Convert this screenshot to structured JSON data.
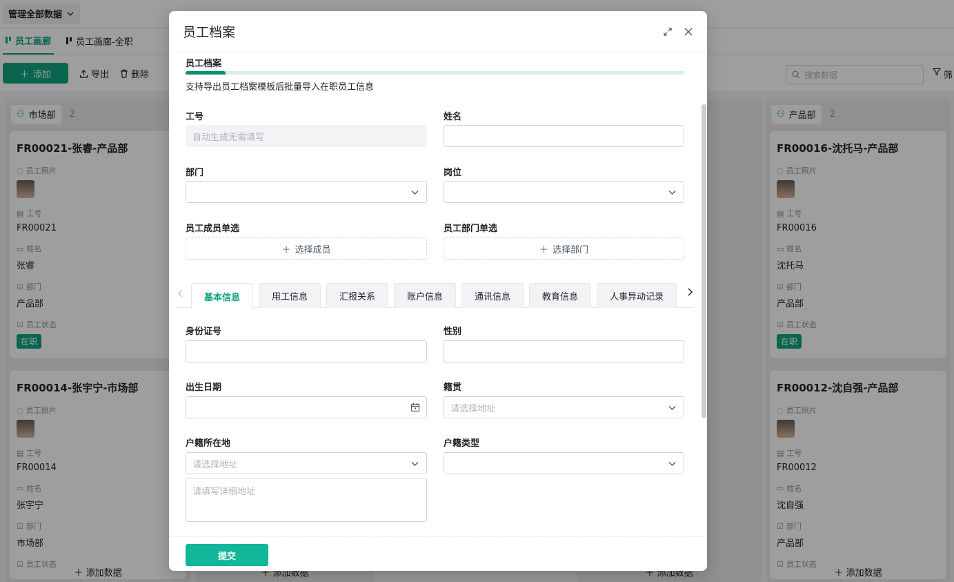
{
  "app": {
    "scope_label": "管理全部数据",
    "view_tabs": [
      "员工画廊",
      "员工画廊-全职"
    ],
    "toolbar": {
      "add": "添加",
      "export": "导出",
      "delete": "删除"
    },
    "search_placeholder": "搜索数据",
    "filter_label": "筛",
    "columns": [
      {
        "name": "市场部",
        "count": "2",
        "footer": "添加数据",
        "cards": [
          {
            "title": "FR00021-张睿-产品部",
            "photo_label": "员工照片",
            "id_label": "工号",
            "id": "FR00021",
            "name_label": "姓名",
            "name": "张睿",
            "dept_label": "部门",
            "dept": "产品部",
            "status_label": "员工状态",
            "status": "在职"
          },
          {
            "title": "FR00014-张宇宁-市场部",
            "photo_label": "员工照片",
            "id_label": "工号",
            "id": "FR00014",
            "name_label": "姓名",
            "name": "张宇宁",
            "dept_label": "部门",
            "dept": "市场部",
            "status_label": "员工状态"
          }
        ]
      },
      {
        "name": "产品部",
        "count": "2",
        "footer": "添加数据",
        "cards": [
          {
            "title": "FR00016-沈托马-产品部",
            "photo_label": "员工照片",
            "id_label": "工号",
            "id": "FR00016",
            "name_label": "姓名",
            "name": "沈托马",
            "dept_label": "部门",
            "dept": "产品部",
            "status_label": "员工状态",
            "status": "在职"
          },
          {
            "title": "FR00012-沈自强-产品部",
            "photo_label": "员工照片",
            "id_label": "工号",
            "id": "FR00012",
            "name_label": "姓名",
            "name": "沈自强",
            "dept_label": "部门",
            "dept": "产品部",
            "status_label": "员工状态"
          }
        ]
      }
    ],
    "hidden_footers": [
      "添加数据",
      "添加数据"
    ]
  },
  "modal": {
    "title": "员工档案",
    "section_title": "员工档案",
    "progress_fraction": 0.08,
    "description": "支持导出员工档案模板后批量导入在职员工信息",
    "fields": {
      "emp_no": {
        "label": "工号",
        "placeholder": "自动生成无需填写"
      },
      "name": {
        "label": "姓名"
      },
      "dept": {
        "label": "部门"
      },
      "position": {
        "label": "岗位"
      },
      "member_single": {
        "label": "员工成员单选",
        "button": "选择成员"
      },
      "dept_single": {
        "label": "员工部门单选",
        "button": "选择部门"
      },
      "id_card": {
        "label": "身份证号"
      },
      "gender": {
        "label": "性别"
      },
      "birth_date": {
        "label": "出生日期"
      },
      "native_place": {
        "label": "籍贯",
        "placeholder": "请选择地址"
      },
      "household_location": {
        "label": "户籍所在地",
        "placeholder": "请选择地址",
        "detail_placeholder": "请填写详细地址"
      },
      "household_type": {
        "label": "户籍类型"
      }
    },
    "tabs": [
      "基本信息",
      "用工信息",
      "汇报关系",
      "账户信息",
      "通讯信息",
      "教育信息",
      "人事异动记录"
    ],
    "active_tab": "基本信息",
    "submit": "提交"
  },
  "colors": {
    "accent": "#10a37f",
    "submit": "#10b798",
    "overlay": "rgba(0,0,0,0.38)"
  },
  "icons": [
    "expand-icon",
    "close-icon",
    "chevron-down-icon",
    "calendar-icon",
    "plus-icon",
    "chevron-left-icon",
    "chevron-right-icon",
    "search-icon",
    "filter-icon",
    "org-icon",
    "upload-icon",
    "trash-icon",
    "gallery-icon"
  ]
}
